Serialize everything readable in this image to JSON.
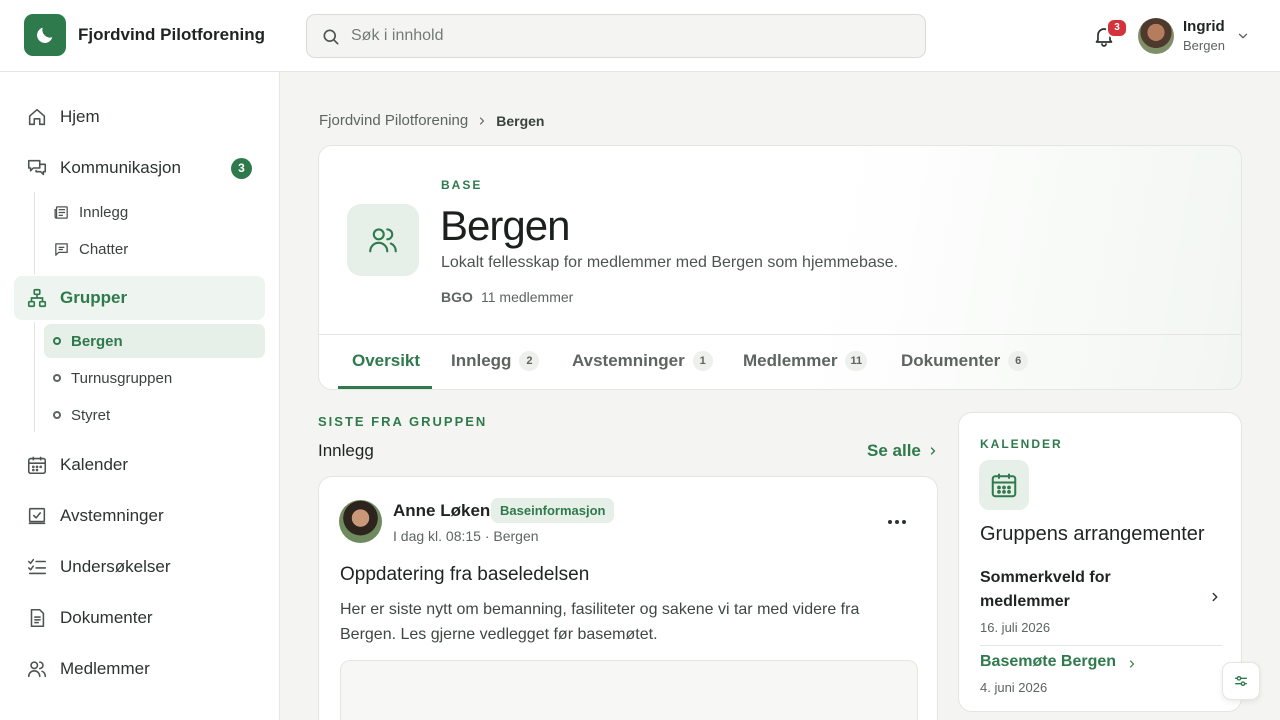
{
  "app": {
    "title": "Fjordvind Pilotforening"
  },
  "search": {
    "placeholder": "Søk i innhold",
    "value": ""
  },
  "notifications": {
    "count": "3"
  },
  "user": {
    "name": "Ingrid",
    "base": "Bergen"
  },
  "sidebar": {
    "items": [
      {
        "label": "Hjem",
        "icon": "home-icon"
      },
      {
        "label": "Kommunikasjon",
        "icon": "chat-bubbles-icon",
        "count": "3"
      },
      {
        "label": "Grupper",
        "icon": "hierarchy-icon"
      },
      {
        "label": "Kalender",
        "icon": "calendar-icon"
      },
      {
        "label": "Avstemninger",
        "icon": "vote-box-icon"
      },
      {
        "label": "Undersøkelser",
        "icon": "checklist-icon"
      },
      {
        "label": "Dokumenter",
        "icon": "document-icon"
      },
      {
        "label": "Medlemmer",
        "icon": "users-icon"
      }
    ],
    "communication_sub": [
      {
        "label": "Innlegg",
        "icon": "newspaper-icon"
      },
      {
        "label": "Chatter",
        "icon": "message-icon"
      }
    ],
    "groups_sub": [
      {
        "label": "Bergen"
      },
      {
        "label": "Turnusgruppen"
      },
      {
        "label": "Styret"
      }
    ]
  },
  "breadcrumb": {
    "root": "Fjordvind Pilotforening",
    "current": "Bergen"
  },
  "group": {
    "kicker": "BASE",
    "title": "Bergen",
    "description": "Lokalt fellesskap for medlemmer med Bergen som hjemmebase.",
    "code": "BGO",
    "members": "11 medlemmer"
  },
  "tabs": [
    {
      "label": "Oversikt",
      "count": ""
    },
    {
      "label": "Innlegg",
      "count": "2"
    },
    {
      "label": "Avstemninger",
      "count": "1"
    },
    {
      "label": "Medlemmer",
      "count": "11"
    },
    {
      "label": "Dokumenter",
      "count": "6"
    }
  ],
  "latest": {
    "kicker": "SISTE FRA GRUPPEN",
    "subtitle": "Innlegg",
    "see_all": "Se alle"
  },
  "post": {
    "author": "Anne Løken",
    "tag": "Baseinformasjon",
    "meta": "I dag kl. 08:15 · Bergen",
    "title": "Oppdatering fra baseledelsen",
    "body": "Her er siste nytt om bemanning, fasiliteter og sakene vi tar med videre fra Bergen. Les gjerne vedlegget før basemøtet."
  },
  "calendar": {
    "kicker": "KALENDER",
    "title": "Gruppens arrangementer",
    "events": [
      {
        "name": "Sommerkveld for medlemmer",
        "date": "16. juli 2026"
      },
      {
        "name": "Basemøte Bergen",
        "date": "4. juni 2026"
      }
    ]
  },
  "colors": {
    "accent": "#2f7a4c",
    "accent_soft": "#e6efe8",
    "badge_red": "#d3343b"
  }
}
